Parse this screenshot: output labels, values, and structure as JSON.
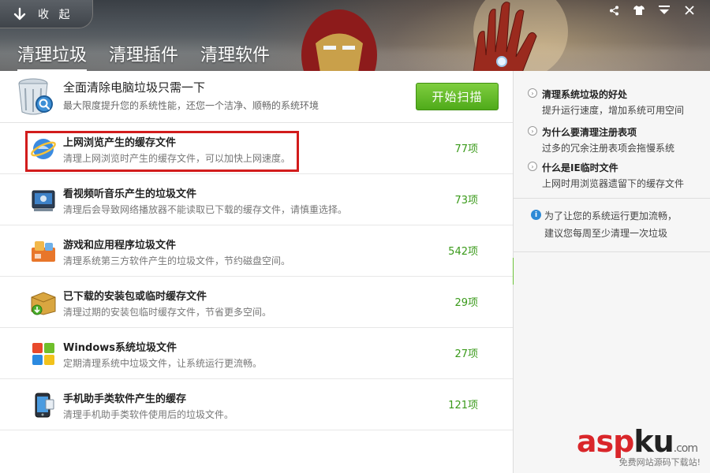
{
  "header": {
    "collapse_label": "收 起",
    "tabs": [
      {
        "label": "清理垃圾",
        "active": true
      },
      {
        "label": "清理插件",
        "active": false
      },
      {
        "label": "清理软件",
        "active": false
      }
    ],
    "window_controls": [
      "share-icon",
      "skin-icon",
      "menu-icon",
      "close-icon"
    ]
  },
  "banner": {
    "title": "全面清除电脑垃圾只需一下",
    "subtitle": "最大限度提升您的系统性能，还您一个洁净、顺畅的系统环境",
    "scan_button": "开始扫描"
  },
  "items": [
    {
      "name": "上网浏览产生的缓存文件",
      "desc": "清理上网浏览时产生的缓存文件，可以加快上网速度。",
      "count": "77项",
      "icon": "ie-browser-icon"
    },
    {
      "name": "看视频听音乐产生的垃圾文件",
      "desc": "清理后会导致网络播放器不能读取已下载的缓存文件，请慎重选择。",
      "count": "73项",
      "icon": "media-player-icon"
    },
    {
      "name": "游戏和应用程序垃圾文件",
      "desc": "清理系统第三方软件产生的垃圾文件，节约磁盘空间。",
      "count": "542项",
      "icon": "apps-icon"
    },
    {
      "name": "已下载的安装包或临时缓存文件",
      "desc": "清理过期的安装包临时缓存文件，节省更多空间。",
      "count": "29项",
      "icon": "download-package-icon"
    },
    {
      "name": "Windows系统垃圾文件",
      "desc": "定期清理系统中垃圾文件，让系统运行更流畅。",
      "count": "27项",
      "icon": "windows-icon"
    },
    {
      "name": "手机助手类软件产生的缓存",
      "desc": "清理手机助手类软件使用后的垃圾文件。",
      "count": "121项",
      "icon": "phone-icon"
    }
  ],
  "sidebar": {
    "tips": [
      {
        "title": "清理系统垃圾的好处",
        "desc": "提升运行速度，增加系统可用空间"
      },
      {
        "title": "为什么要清理注册表项",
        "desc": "过多的冗余注册表项会拖慢系统"
      },
      {
        "title": "什么是IE临时文件",
        "desc": "上网时用浏览器遗留下的缓存文件"
      }
    ],
    "info_line1": "为了让您的系统运行更加流畅，",
    "info_line2": "建议您每周至少清理一次垃圾"
  },
  "watermark": {
    "logo_a": "asp",
    "logo_k": "ku",
    "logo_com": ".com",
    "tagline": "免费网站源码下载站!"
  },
  "colors": {
    "accent_green": "#4faa1a",
    "count_green": "#3a9a1a",
    "highlight_red": "#d21c1c"
  }
}
